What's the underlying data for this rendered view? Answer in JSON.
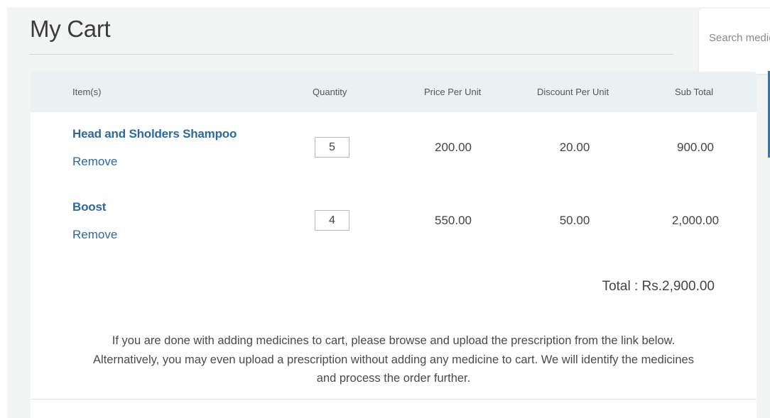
{
  "page": {
    "title": "My Cart"
  },
  "search": {
    "placeholder": "Search medicines"
  },
  "table": {
    "columns": {
      "item": "Item(s)",
      "quantity": "Quantity",
      "price": "Price Per Unit",
      "discount": "Discount Per Unit",
      "subtotal": "Sub Total"
    },
    "rows": [
      {
        "name": "Head and Sholders Shampoo",
        "remove_label": "Remove",
        "quantity": "5",
        "price": "200.00",
        "discount": "20.00",
        "subtotal": "900.00"
      },
      {
        "name": "Boost",
        "remove_label": "Remove",
        "quantity": "4",
        "price": "550.00",
        "discount": "50.00",
        "subtotal": "2,000.00"
      }
    ]
  },
  "total": {
    "label": "Total : Rs.2,900.00"
  },
  "info": {
    "line1": "If you are done with adding medicines to cart, please browse and upload the prescription from the link below.",
    "line2": "Alternatively, you may even upload a prescription without adding any medicine to cart. We will identify the medicines",
    "line3": "and process the order further."
  },
  "colors": {
    "link": "#2a6aa3",
    "header_bg": "#ebf1f2",
    "page_bg": "#f3f4f4",
    "accent": "#2a7ab5"
  }
}
